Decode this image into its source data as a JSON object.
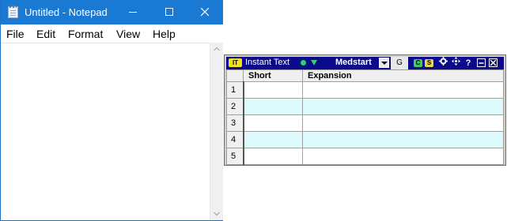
{
  "notepad": {
    "title": "Untitled - Notepad",
    "menu": [
      "File",
      "Edit",
      "Format",
      "View",
      "Help"
    ],
    "content": ""
  },
  "instant_text": {
    "logo": "IT",
    "title": "Instant Text",
    "profile": "Medstart",
    "g_button": "G",
    "badges": [
      "C",
      "S"
    ],
    "icons": [
      "gear-icon",
      "move-icon",
      "help-icon",
      "minimize-icon",
      "close-icon"
    ],
    "help_glyph": "?",
    "columns": [
      "Short",
      "Expansion"
    ],
    "rows": [
      {
        "num": "1",
        "short": "",
        "expansion": ""
      },
      {
        "num": "2",
        "short": "",
        "expansion": ""
      },
      {
        "num": "3",
        "short": "",
        "expansion": ""
      },
      {
        "num": "4",
        "short": "",
        "expansion": ""
      },
      {
        "num": "5",
        "short": "",
        "expansion": ""
      }
    ]
  },
  "colors": {
    "notepad_titlebar": "#1979d3",
    "it_titlebar": "#0a0a8a",
    "row_alt": "#ddfbfd",
    "status_green": "#2fd26a"
  }
}
